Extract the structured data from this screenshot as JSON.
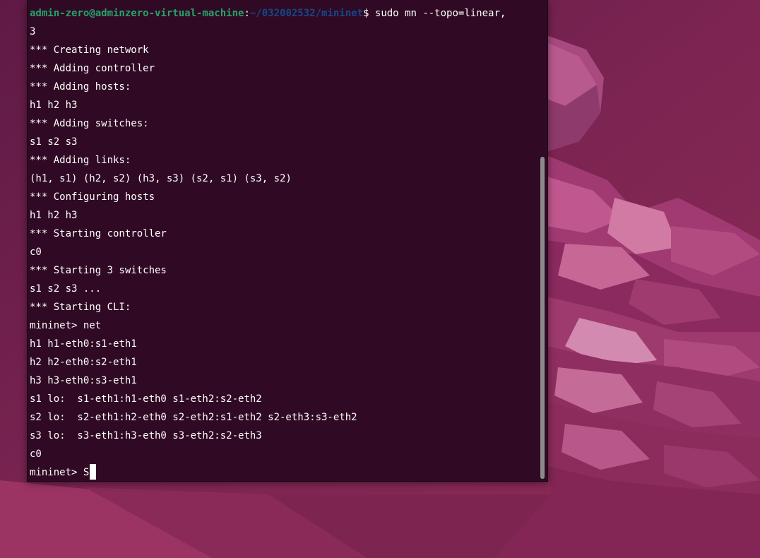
{
  "terminal": {
    "prompt": {
      "user_host": "admin-zero@adminzero-virtual-machine",
      "colon": ":",
      "path": "~/032002532/mininet",
      "dollar": "$",
      "command": " sudo mn --topo=linear,"
    },
    "lines": [
      "3",
      "*** Creating network",
      "*** Adding controller",
      "*** Adding hosts:",
      "h1 h2 h3",
      "*** Adding switches:",
      "s1 s2 s3",
      "*** Adding links:",
      "(h1, s1) (h2, s2) (h3, s3) (s2, s1) (s3, s2)",
      "*** Configuring hosts",
      "h1 h2 h3",
      "*** Starting controller",
      "c0",
      "*** Starting 3 switches",
      "s1 s2 s3 ...",
      "*** Starting CLI:",
      "mininet> net",
      "h1 h1-eth0:s1-eth1",
      "h2 h2-eth0:s2-eth1",
      "h3 h3-eth0:s3-eth1",
      "s1 lo:  s1-eth1:h1-eth0 s1-eth2:s2-eth2",
      "s2 lo:  s2-eth1:h2-eth0 s2-eth2:s1-eth2 s2-eth3:s3-eth2",
      "s3 lo:  s3-eth1:h3-eth0 s3-eth2:s2-eth3",
      "c0"
    ],
    "current_input": "mininet> S"
  },
  "colors": {
    "terminal_bg": "#300a24",
    "prompt_user": "#26a269",
    "prompt_path": "#12488b",
    "text": "#ffffff"
  }
}
